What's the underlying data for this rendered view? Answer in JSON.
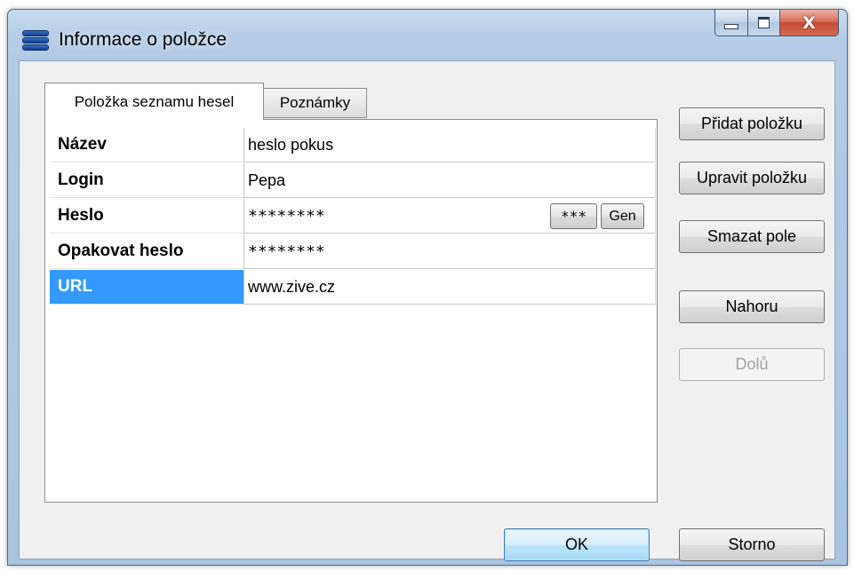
{
  "window": {
    "title": "Informace o položce",
    "close_glyph": "X"
  },
  "tabs": [
    {
      "label": "Položka seznamu hesel",
      "active": true
    },
    {
      "label": "Poznámky",
      "active": false
    }
  ],
  "fields": [
    {
      "label": "Název",
      "value": "heslo pokus"
    },
    {
      "label": "Login",
      "value": "Pepa"
    },
    {
      "label": "Heslo",
      "value": "********"
    },
    {
      "label": "Opakovat heslo",
      "value": "********"
    },
    {
      "label": "URL",
      "value": "www.zive.cz",
      "selected": true
    }
  ],
  "password_buttons": {
    "show": "***",
    "generate": "Gen"
  },
  "side_buttons": {
    "add": "Přidat položku",
    "edit": "Upravit položku",
    "delete": "Smazat pole",
    "up": "Nahoru",
    "down": "Dolů"
  },
  "dialog_buttons": {
    "ok": "OK",
    "cancel": "Storno"
  },
  "colors": {
    "selection": "#3399ff",
    "close_button": "#c74b36",
    "title_gradient": "#b5cde6"
  }
}
